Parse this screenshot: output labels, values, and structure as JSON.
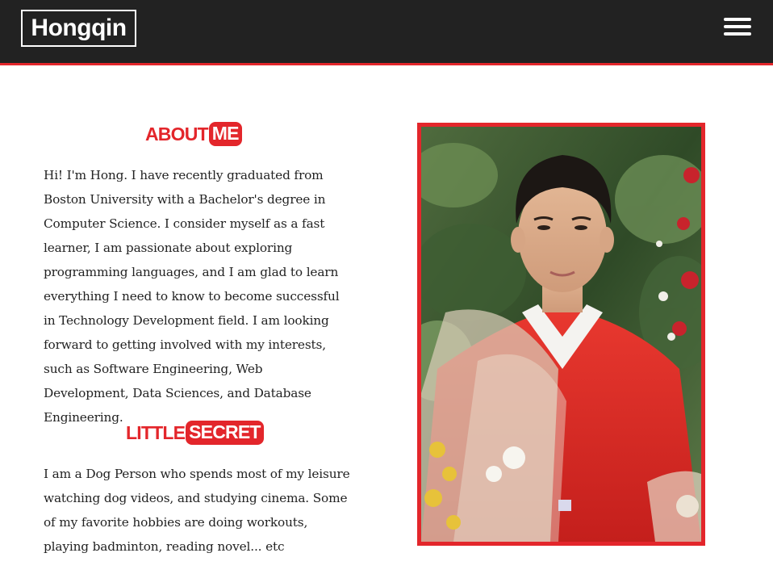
{
  "navbar": {
    "brand": "Hongqin",
    "menu_icon": "hamburger-menu-icon"
  },
  "about": {
    "heading_plain": "ABOUT",
    "heading_highlight": "ME",
    "text": "Hi! I'm Hong. I have recently graduated from Boston University with a Bachelor's degree in Computer Science. I consider myself as a fast learner, I am passionate about exploring programming languages, and I am glad to learn everything I need to know to become successful in Technology Development field. I am looking forward to getting involved with my interests, such as Software Engineering, Web Development, Data Sciences, and Database Engineering."
  },
  "secret": {
    "heading_plain": "LITTLE",
    "heading_highlight": "SECRET",
    "text": "I am a Dog Person who spends most of my leisure watching dog videos, and studying cinema. Some of my favorite hobbies are doing workouts, playing badminton, reading novel... etc"
  },
  "colors": {
    "accent": "#e3262b",
    "navbar_bg": "#222222",
    "text": "#222222"
  }
}
